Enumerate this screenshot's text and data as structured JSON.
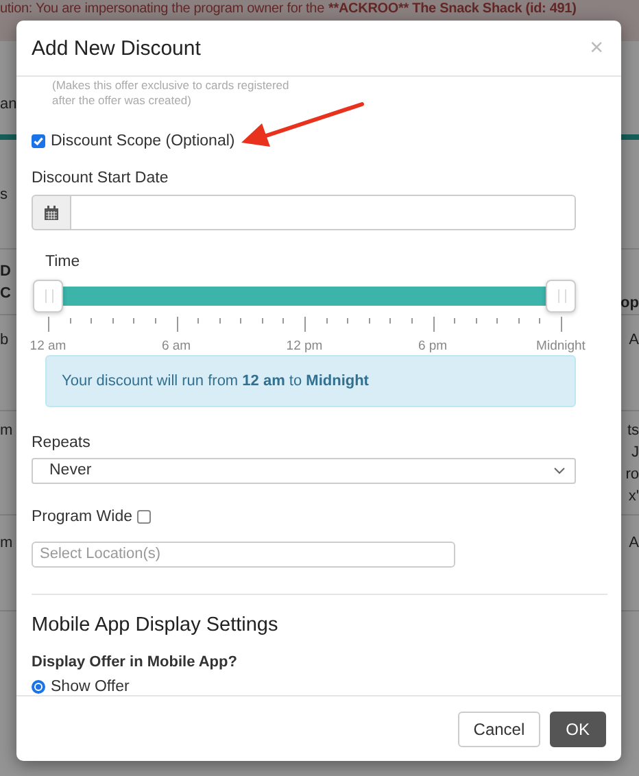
{
  "banner": {
    "text": "ution: You are impersonating the program owner for the",
    "emphasis": "**ACKROO** The Snack Shack (id: 491)"
  },
  "background": {
    "rows": [
      {
        "kind": "cell",
        "left": [
          "an"
        ],
        "right": []
      },
      {
        "kind": "cell",
        "left": [
          "s"
        ],
        "right": []
      },
      {
        "kind": "header",
        "left": [
          "D",
          "C"
        ],
        "right": [
          "op"
        ]
      },
      {
        "kind": "cell",
        "left": [
          "b"
        ],
        "right": [
          "A"
        ]
      },
      {
        "kind": "cell",
        "left": [
          "m"
        ],
        "right": [
          "ts",
          "J",
          "ro",
          "x'"
        ]
      },
      {
        "kind": "cell",
        "left": [
          "m"
        ],
        "right": [
          "A"
        ]
      }
    ]
  },
  "dialog": {
    "title": "Add New Discount",
    "close": "×",
    "note_lines": [
      "(Makes this offer exclusive to cards registered",
      "after the offer was created)"
    ],
    "scope": {
      "label": "Discount Scope (Optional)",
      "checked": true
    },
    "start_date": {
      "label": "Discount Start Date"
    },
    "time": {
      "label": "Time",
      "level": 1,
      "tick_labels": [
        "12 am",
        "6 am",
        "12 pm",
        "6 pm",
        "Midnight"
      ]
    },
    "info": "Your discount will run from **12 am** to **Midnight**",
    "repeats": {
      "label": "Repeats",
      "value": "Never"
    },
    "program_wide": {
      "label": "Program Wide",
      "checked": false
    },
    "locations": {
      "placeholder": "Select Location(s)"
    },
    "mobile_heading": "Mobile App Display Settings",
    "display_question": "Display Offer in Mobile App?",
    "display_options": [
      {
        "label": "Show Offer",
        "selected": true
      }
    ],
    "buttons": [
      {
        "label": "Cancel",
        "kind": "secondary"
      },
      {
        "label": "OK",
        "kind": "primary"
      }
    ]
  }
}
